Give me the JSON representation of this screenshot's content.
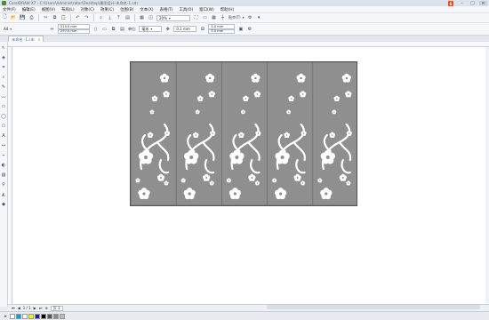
{
  "titlebar": {
    "title": "CorelDRAW X7 - C:\\Users\\Administrator\\Desktop\\墨图设计-未命名-1.cdr"
  },
  "logo": {
    "text": "S"
  },
  "menu": [
    "文件(F)",
    "编辑(E)",
    "视图(V)",
    "布局(L)",
    "对象(C)",
    "效果(C)",
    "位图(B)",
    "文本(X)",
    "表格(T)",
    "工具(O)",
    "窗口(W)",
    "帮助(H)"
  ],
  "toolbar1": {
    "zoom": "20%",
    "snap_label": "贴齐(T)"
  },
  "toolbar2": {
    "page_size": "A4",
    "width": "210.0 mm",
    "height": "297.0 mm",
    "units_label": "单位:",
    "units_value": "毫米",
    "nudge": "0.1 mm",
    "dup_x": "5.0 mm",
    "dup_y": "5.0 mm"
  },
  "tab": {
    "label": "未命名 -1.cdr"
  },
  "bottombar": {
    "page_count": "1 / 1",
    "page_tab": "页 1"
  },
  "colors": {
    "panel_fill": "#8f8f8f",
    "flower_fill": "#ffffff",
    "palette": [
      "#00a0e9",
      "#ffffff",
      "#fff100",
      "#1d2088",
      "#000000",
      "#555555",
      "#888888",
      "#bbbbbb"
    ]
  },
  "panels": [
    {
      "label": ""
    },
    {
      "label": ""
    },
    {
      "label": ""
    },
    {
      "label": ""
    },
    {
      "label": ""
    }
  ]
}
